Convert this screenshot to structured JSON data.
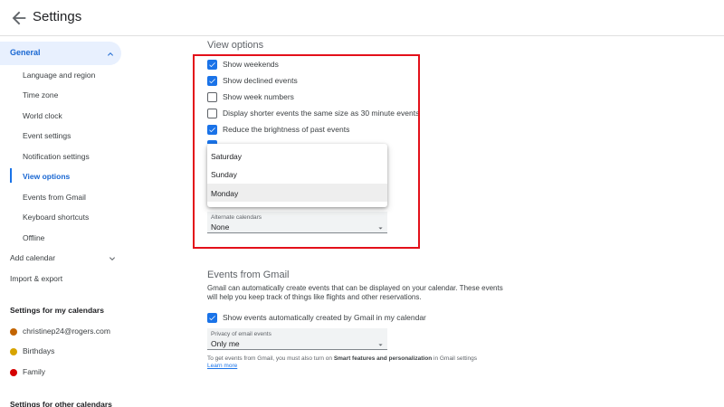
{
  "header": {
    "title": "Settings",
    "back_icon": "arrow-left-icon"
  },
  "sidebar": {
    "general": {
      "label": "General",
      "icon": "chevron-up-icon"
    },
    "sub_items": [
      "Language and region",
      "Time zone",
      "World clock",
      "Event settings",
      "Notification settings",
      "View options",
      "Events from Gmail",
      "Keyboard shortcuts",
      "Offline"
    ],
    "active_sub_item": "View options",
    "add_calendar": {
      "label": "Add calendar",
      "icon": "chevron-down-icon"
    },
    "import_export": "Import & export",
    "my_calendars_heading": "Settings for my calendars",
    "my_calendars": [
      {
        "label": "christinep24@rogers.com",
        "color": "#c26401"
      },
      {
        "label": "Birthdays",
        "color": "#d7a400"
      },
      {
        "label": "Family",
        "color": "#d50000"
      }
    ],
    "other_calendars_heading": "Settings for other calendars"
  },
  "view_options": {
    "heading": "View options",
    "options": [
      {
        "label": "Show weekends",
        "checked": true
      },
      {
        "label": "Show declined events",
        "checked": true
      },
      {
        "label": "Show week numbers",
        "checked": false
      },
      {
        "label": "Display shorter events the same size as 30 minute events",
        "checked": false
      },
      {
        "label": "Reduce the brightness of past events",
        "checked": true
      }
    ],
    "week_start_dropdown": {
      "options": [
        "Saturday",
        "Sunday",
        "Monday"
      ],
      "selected": "Monday"
    },
    "alternate_calendars": {
      "label": "Alternate calendars",
      "value": "None"
    }
  },
  "events_from_gmail": {
    "heading": "Events from Gmail",
    "description": "Gmail can automatically create events that can be displayed on your calendar. These events will help you keep track of things like flights and other reservations.",
    "show_events_option": {
      "label": "Show events automatically created by Gmail in my calendar",
      "checked": true
    },
    "privacy": {
      "label": "Privacy of email events",
      "value": "Only me"
    },
    "note_prefix": "To get events from Gmail, you must also turn on ",
    "note_bold": "Smart features and personalization",
    "note_suffix": " in Gmail settings",
    "learn_more": "Learn more"
  },
  "colors": {
    "accent": "#1a73e8",
    "highlight_border": "#e3101a",
    "nav_active_bg": "#e8f0fe"
  }
}
